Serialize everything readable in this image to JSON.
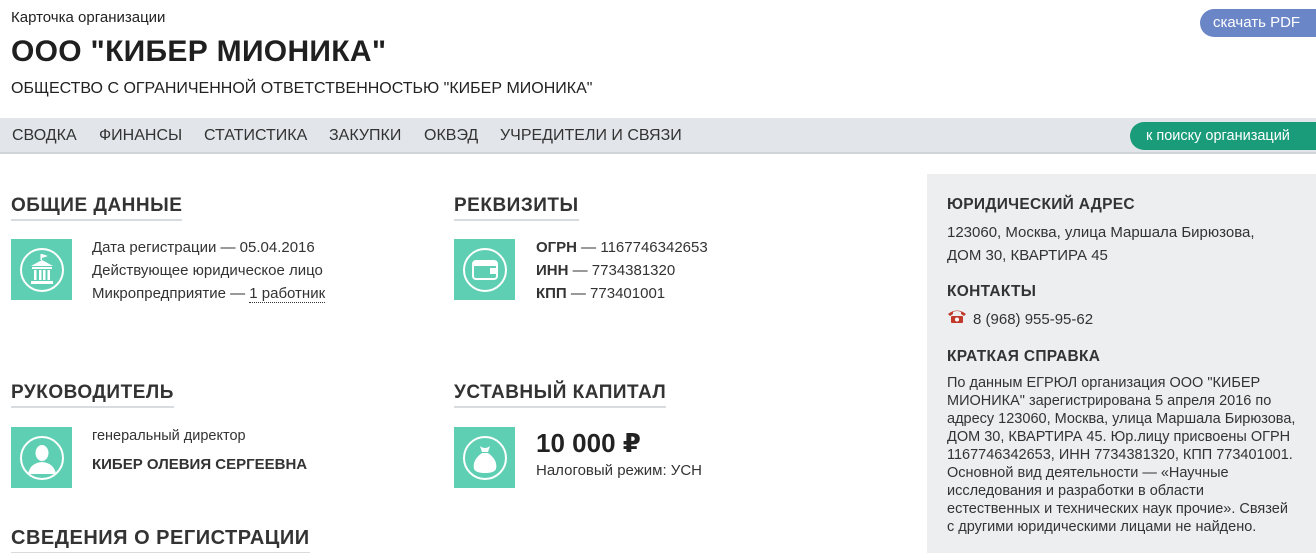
{
  "header": {
    "breadcrumb": "Карточка организации",
    "title": "ООО \"КИБЕР МИОНИКА\"",
    "full_name": "ОБЩЕСТВО С ОГРАНИЧЕННОЙ ОТВЕТСТВЕННОСТЬЮ \"КИБЕР МИОНИКА\"",
    "pdf_button": "скачать PDF"
  },
  "nav": {
    "items": [
      "СВОДКА",
      "ФИНАНСЫ",
      "СТАТИСТИКА",
      "ЗАКУПКИ",
      "ОКВЭД",
      "УЧРЕДИТЕЛИ И СВЯЗИ"
    ],
    "search_button": "к поиску организаций"
  },
  "general": {
    "title": "ОБЩИЕ ДАННЫЕ",
    "reg_date": "Дата регистрации — 05.04.2016",
    "status": "Действующее юридическое лицо",
    "size_prefix": "Микропредприятие — ",
    "employees": "1 работник",
    "icon": "building-icon"
  },
  "requisites": {
    "title": "РЕКВИЗИТЫ",
    "ogrn_label": "ОГРН",
    "ogrn_value": " — 1167746342653",
    "inn_label": "ИНН",
    "inn_value": " — 7734381320",
    "kpp_label": "КПП",
    "kpp_value": " — 773401001",
    "icon": "wallet-icon"
  },
  "director": {
    "title": "РУКОВОДИТЕЛЬ",
    "position": "генеральный директор",
    "name": "КИБЕР ОЛЕВИЯ СЕРГЕЕВНА",
    "icon": "person-icon"
  },
  "capital": {
    "title": "УСТАВНЫЙ КАПИТАЛ",
    "amount": "10 000 ₽",
    "tax": "Налоговый режим: УСН",
    "icon": "money-bag-icon"
  },
  "registration": {
    "title": "СВЕДЕНИЯ О РЕГИСТРАЦИИ"
  },
  "sidebar": {
    "address_title": "ЮРИДИЧЕСКИЙ АДРЕС",
    "address_line1": "123060, Москва, улица Маршала Бирюзова,",
    "address_line2": "ДОМ 30, КВАРТИРА 45",
    "contacts_title": "КОНТАКТЫ",
    "phone": "8 (968) 955-95-62",
    "summary_title": "КРАТКАЯ СПРАВКА",
    "summary": "По данным ЕГРЮЛ организация ООО \"КИБЕР МИОНИКА\" зарегистрирована 5 апреля 2016 по адресу 123060, Москва, улица Маршала Бирюзова, ДОМ 30, КВАРТИРА 45. Юр.лицу присвоены ОГРН 1167746342653, ИНН 7734381320, КПП 773401001. Основной вид деятельности — «Научные исследования и разработки в области естественных и технических наук прочие». Связей с другими юридическими лицами не найдено."
  },
  "colors": {
    "pdf_button": "#6b86c6",
    "search_button": "#1a9b7a",
    "icon_bg": "#5fcfb4",
    "navbar": "#e2e6ea",
    "sidebar": "#eceef0"
  }
}
